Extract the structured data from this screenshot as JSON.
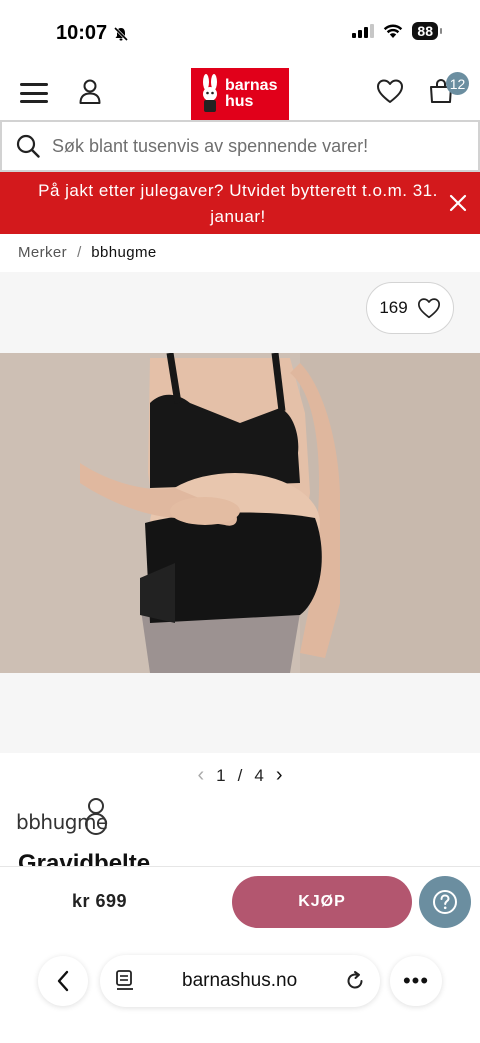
{
  "status_bar": {
    "time": "10:07",
    "battery": "88"
  },
  "header": {
    "logo_line1": "barnas",
    "logo_line2": "hus",
    "cart_count": "12"
  },
  "search": {
    "placeholder": "Søk blant tusenvis av spennende varer!"
  },
  "banner": {
    "text": "På jakt etter julegaver? Utvidet bytterett t.o.m. 31. januar!"
  },
  "breadcrumb": {
    "parent": "Merker",
    "separator": "/",
    "current": "bbhugme"
  },
  "gallery": {
    "favorites_count": "169",
    "page_current": "1",
    "page_separator": "/",
    "page_total": "4",
    "image_alt": "product-photo-maternity-belt"
  },
  "product": {
    "brand": "bbhugme",
    "title": "Gravidbelte"
  },
  "buy_bar": {
    "price": "kr 699",
    "buy_label": "KJØP"
  },
  "browser": {
    "url": "barnashus.no",
    "more_label": "•••"
  },
  "colors": {
    "brand_red": "#e1001a",
    "banner_red": "#d3191c",
    "buy_button": "#b3566f",
    "accent_blue": "#6b8ea0"
  }
}
